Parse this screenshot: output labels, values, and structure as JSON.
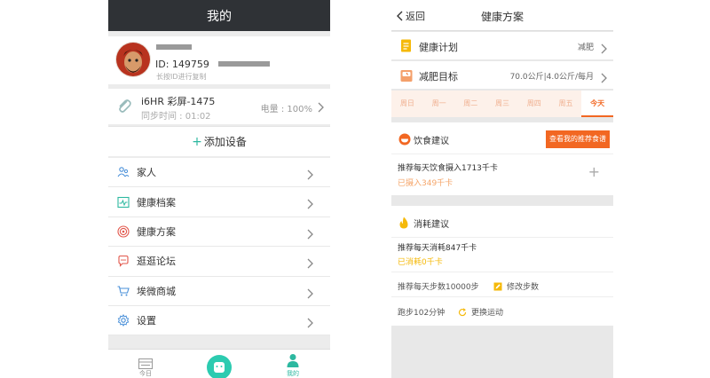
{
  "left": {
    "title": "我的",
    "profile": {
      "id_prefix": "ID: 149759",
      "id_hint": "长按ID进行复制"
    },
    "device": {
      "name": "i6HR 彩屏-1475",
      "sync": "同步时间 : 01:02",
      "battery": "电量 : 100%"
    },
    "add_device": {
      "plus": "+",
      "label": "添加设备"
    },
    "menu": [
      {
        "label": "家人",
        "icon": "family-icon"
      },
      {
        "label": "健康档案",
        "icon": "health-record-icon"
      },
      {
        "label": "健康方案",
        "icon": "target-icon"
      },
      {
        "label": "逛逛论坛",
        "icon": "forum-icon"
      },
      {
        "label": "埃微商城",
        "icon": "cart-icon"
      },
      {
        "label": "设置",
        "icon": "gear-icon"
      }
    ],
    "tabs": {
      "today": "今日",
      "mine": "我的"
    },
    "colors": {
      "accent": "#2ccbb0",
      "titlebar": "#2f3236"
    }
  },
  "right": {
    "back": "返回",
    "title": "健康方案",
    "plan": {
      "label": "健康计划",
      "value": "减肥"
    },
    "goal": {
      "label": "减肥目标",
      "value": "70.0公斤|4.0公斤/每月"
    },
    "days": [
      "周日",
      "周一",
      "周二",
      "周三",
      "周四",
      "周五",
      "今天"
    ],
    "diet": {
      "heading": "饮食建议",
      "button": "查看我的推荐食谱",
      "recommend": "推荐每天饮食摄入1713千卡",
      "taken": "已摄入349千卡",
      "plus": "+"
    },
    "burn": {
      "heading": "消耗建议",
      "recommend": "推荐每天消耗847千卡",
      "burned": "已消耗0千卡",
      "steps": "推荐每天步数10000步",
      "edit_steps": "修改步数",
      "run": "跑步102分钟",
      "change_sport": "更换运动"
    },
    "colors": {
      "accent": "#f26722",
      "yellow": "#f5b90a"
    }
  }
}
